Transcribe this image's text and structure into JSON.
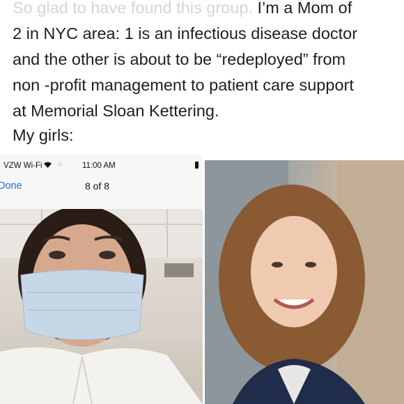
{
  "post": {
    "text_faded": "So glad to have found this group.",
    "text_line1_rest": " I’m a Mom of",
    "text_line2": "2 in NYC area:  1 is an infectious disease doctor",
    "text_line3": "and the other is about to be “redeployed” from",
    "text_line4": "non -profit management to patient care support",
    "text_line5": "at Memorial Sloan Kettering.",
    "text_girls": "My girls:"
  },
  "phone_screenshot": {
    "carrier": "VZW Wi-Fi",
    "wifi_icon": "wifi-icon",
    "time": "11:00 AM",
    "done_label": "Done",
    "page_counter": "8 of 8"
  },
  "photos": {
    "left": "selfie-photo",
    "right": "portrait-photo"
  }
}
